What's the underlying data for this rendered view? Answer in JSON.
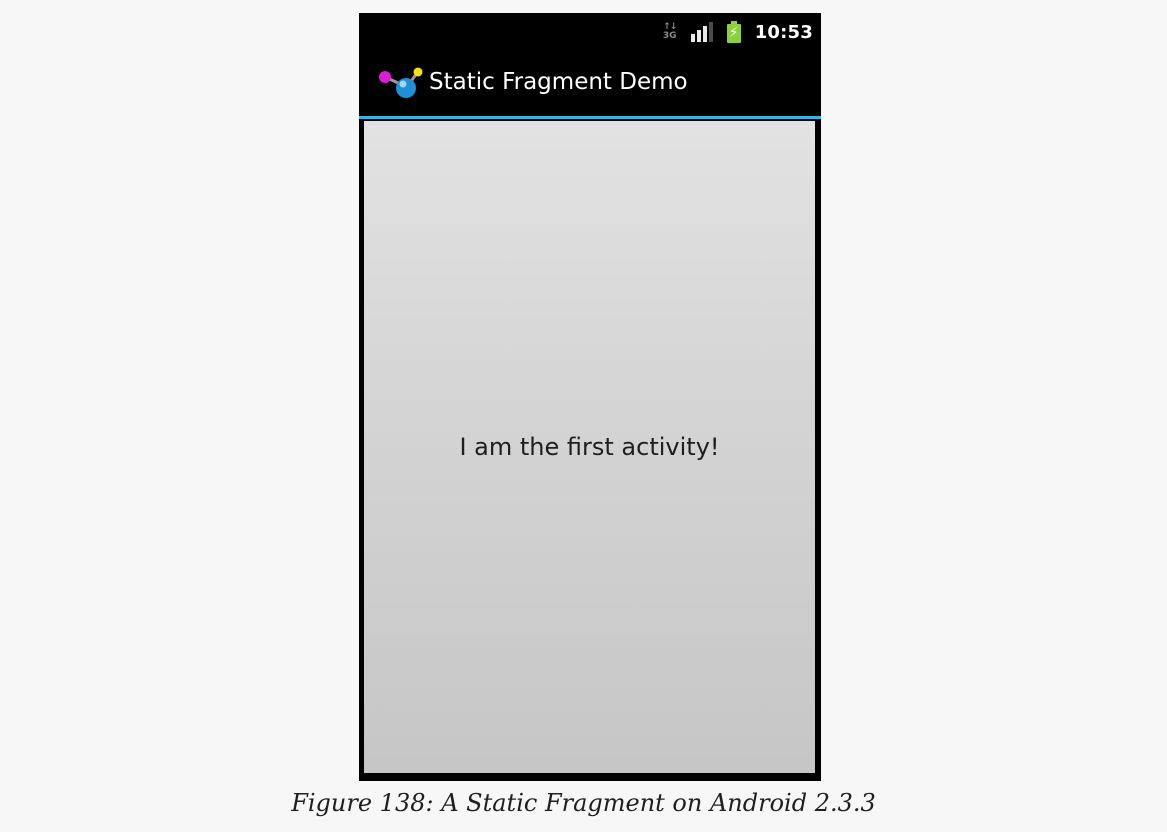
{
  "status_bar": {
    "network_type": "3G",
    "network_arrows": "↑↓",
    "time": "10:53",
    "icons": [
      "data-3g-icon",
      "signal-strength-icon",
      "battery-charging-icon"
    ]
  },
  "app_bar": {
    "icon": "app-molecule-icon",
    "title": "Static Fragment Demo",
    "divider_color": "#33b5e5"
  },
  "content": {
    "message": "I am the first activity!"
  },
  "caption": "Figure 138: A Static Fragment on Android 2.3.3"
}
